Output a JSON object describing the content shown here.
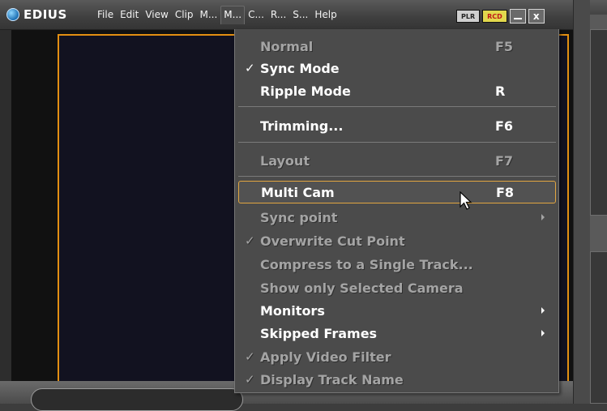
{
  "app": {
    "name": "EDIUS"
  },
  "menubar": {
    "items": [
      {
        "label": "File"
      },
      {
        "label": "Edit"
      },
      {
        "label": "View"
      },
      {
        "label": "Clip"
      },
      {
        "label": "M..."
      },
      {
        "label": "M...",
        "active": true
      },
      {
        "label": "C..."
      },
      {
        "label": "R..."
      },
      {
        "label": "S..."
      },
      {
        "label": "Help"
      }
    ]
  },
  "window": {
    "plr_label": "PLR",
    "rcd_label": "RCD",
    "minimize_label": "_",
    "close_label": "x"
  },
  "colors": {
    "accent_orange": "#e38f12",
    "highlight_border": "#e1a541",
    "menu_bg": "#4b4b4b",
    "rcd_yellow": "#e2d84d",
    "rcd_red": "#c01717"
  },
  "mode_menu": {
    "items": [
      {
        "label": "Normal",
        "shortcut": "F5",
        "checked": false,
        "enabled": false
      },
      {
        "label": "Sync Mode",
        "shortcut": "",
        "checked": true,
        "enabled": true
      },
      {
        "label": "Ripple Mode",
        "shortcut": "R",
        "checked": false,
        "enabled": true
      },
      {
        "label": "Trimming...",
        "shortcut": "F6",
        "checked": false,
        "enabled": true
      },
      {
        "label": "Layout",
        "shortcut": "F7",
        "checked": false,
        "enabled": false
      },
      {
        "label": "Multi Cam",
        "shortcut": "F8",
        "checked": false,
        "enabled": true,
        "highlighted": true
      },
      {
        "label": "Sync point",
        "shortcut": "",
        "checked": false,
        "enabled": false,
        "submenu": true
      },
      {
        "label": "Overwrite Cut Point",
        "shortcut": "",
        "checked": true,
        "enabled": false
      },
      {
        "label": "Compress to a Single Track...",
        "shortcut": "",
        "checked": false,
        "enabled": false
      },
      {
        "label": "Show only Selected Camera",
        "shortcut": "",
        "checked": false,
        "enabled": false
      },
      {
        "label": "Monitors",
        "shortcut": "",
        "checked": false,
        "enabled": true,
        "submenu": true
      },
      {
        "label": "Skipped Frames",
        "shortcut": "",
        "checked": false,
        "enabled": true,
        "submenu": true
      },
      {
        "label": "Apply Video Filter",
        "shortcut": "",
        "checked": true,
        "enabled": false
      },
      {
        "label": "Display Track Name",
        "shortcut": "",
        "checked": true,
        "enabled": false
      }
    ],
    "check_glyph": "✓"
  }
}
